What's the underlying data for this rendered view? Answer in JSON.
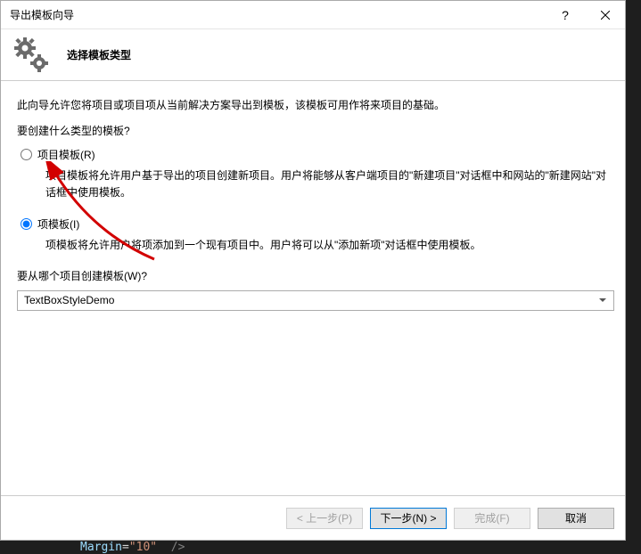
{
  "titlebar": {
    "title": "导出模板向导"
  },
  "header": {
    "title": "选择模板类型"
  },
  "content": {
    "intro": "此向导允许您将项目或项目项从当前解决方案导出到模板，该模板可用作将来项目的基础。",
    "question1": "要创建什么类型的模板?",
    "option1": {
      "label": "项目模板(R)"
    },
    "option1_desc": "项目模板将允许用户基于导出的项目创建新项目。用户将能够从客户端项目的\"新建项目\"对话框中和网站的\"新建网站\"对话框中使用模板。",
    "option2": {
      "label": "项模板(I)"
    },
    "option2_desc": "项模板将允许用户将项添加到一个现有项目中。用户将可以从\"添加新项\"对话框中使用模板。",
    "question2": "要从哪个项目创建模板(W)?",
    "combo_value": "TextBoxStyleDemo"
  },
  "footer": {
    "prev": "< 上一步(P)",
    "next": "下一步(N) >",
    "finish": "完成(F)",
    "cancel": "取消"
  },
  "code": {
    "attr": "Margin",
    "val": "\"10\""
  }
}
